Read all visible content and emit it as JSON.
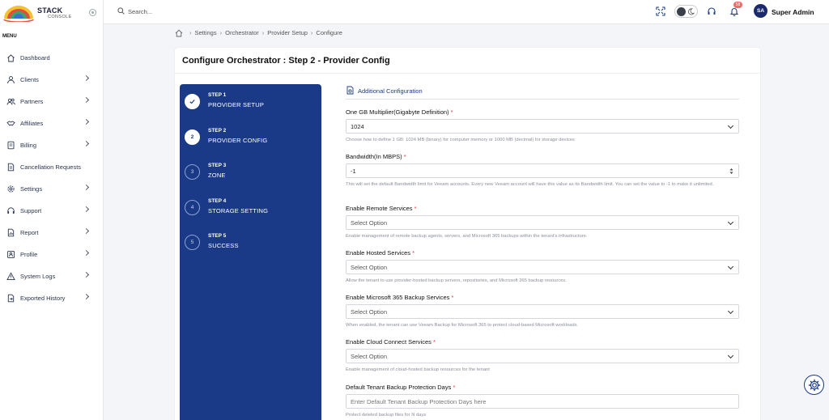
{
  "brand": {
    "name": "STACK",
    "tagline": "CONSOLE"
  },
  "sidebar": {
    "menu_title": "MENU",
    "items": [
      {
        "label": "Dashboard",
        "icon": "home-icon",
        "chevron": false
      },
      {
        "label": "Clients",
        "icon": "user-icon",
        "chevron": true
      },
      {
        "label": "Partners",
        "icon": "users-icon",
        "chevron": true
      },
      {
        "label": "Affiliates",
        "icon": "handshake-icon",
        "chevron": true
      },
      {
        "label": "Billing",
        "icon": "billing-icon",
        "chevron": true
      },
      {
        "label": "Cancellation Requests",
        "icon": "document-icon",
        "chevron": false
      },
      {
        "label": "Settings",
        "icon": "gear-icon",
        "chevron": true
      },
      {
        "label": "Support",
        "icon": "headset-icon",
        "chevron": true
      },
      {
        "label": "Report",
        "icon": "report-icon",
        "chevron": true
      },
      {
        "label": "Profile",
        "icon": "profile-icon",
        "chevron": true
      },
      {
        "label": "System Logs",
        "icon": "warning-icon",
        "chevron": true
      },
      {
        "label": "Exported History",
        "icon": "export-icon",
        "chevron": true
      }
    ]
  },
  "topbar": {
    "search_placeholder": "Search...",
    "notification_count": "58",
    "user_initials": "SA",
    "user_name": "Super Admin"
  },
  "breadcrumb": [
    "Settings",
    "Orchestrator",
    "Provider Setup",
    "Configure"
  ],
  "page": {
    "title": "Configure Orchestrator : Step 2 - Provider Config"
  },
  "steps": [
    {
      "number": "1",
      "title": "STEP 1",
      "name": "PROVIDER SETUP",
      "state": "done"
    },
    {
      "number": "2",
      "title": "STEP 2",
      "name": "PROVIDER CONFIG",
      "state": "active"
    },
    {
      "number": "3",
      "title": "STEP 3",
      "name": "ZONE",
      "state": "pending"
    },
    {
      "number": "4",
      "title": "STEP 4",
      "name": "STORAGE SETTING",
      "state": "pending"
    },
    {
      "number": "5",
      "title": "STEP 5",
      "name": "SUCCESS",
      "state": "pending"
    }
  ],
  "form": {
    "section_title": "Additional Configuration",
    "fields": [
      {
        "label": "One GB Multiplier(Gigabyte Definition)",
        "required": true,
        "type": "select",
        "value": "1024",
        "help": "Choose how to define 1 GB: 1024 MB (binary) for computer memory or 1000 MB (decimal) for storage devices"
      },
      {
        "label": "Bandwidth(In MBPS)",
        "required": true,
        "type": "number",
        "value": "-1",
        "help": "This will set the default Bandwidth limit for Veeam accounts. Every new Veeam account will have this value as its Bandwidth limit. You can set the value to -1 to make it unlimited."
      },
      {
        "label": "Enable Remote Services",
        "required": true,
        "type": "select",
        "value": "Select Option",
        "help": "Enable management of remote backup agents, servers, and Microsoft 365 backups within the tenant's infrastructure."
      },
      {
        "label": "Enable Hosted Services",
        "required": true,
        "type": "select",
        "value": "Select Option",
        "help": "Allow the tenant to use provider-hosted backup servers, repositories, and Microsoft 365 backup resources."
      },
      {
        "label": "Enable Microsoft 365 Backup Services",
        "required": true,
        "type": "select",
        "value": "Select Option",
        "help": "When enabled, the tenant can use Veeam Backup for Microsoft 365 to protect cloud-based Microsoft workloads."
      },
      {
        "label": "Enable Cloud Connect Services",
        "required": true,
        "type": "select",
        "value": "Select Option",
        "help": "Enable management of cloud-hosted backup resources for the tenant"
      },
      {
        "label": "Default Tenant Backup Protection Days",
        "required": true,
        "type": "text",
        "placeholder": "Enter Default Tenant Backup Protection Days here",
        "help": "Protect deleted backup files for N days"
      }
    ]
  },
  "colors": {
    "primary": "#1a3a88",
    "required": "#e23a3a",
    "badge": "#ef6b6b"
  }
}
